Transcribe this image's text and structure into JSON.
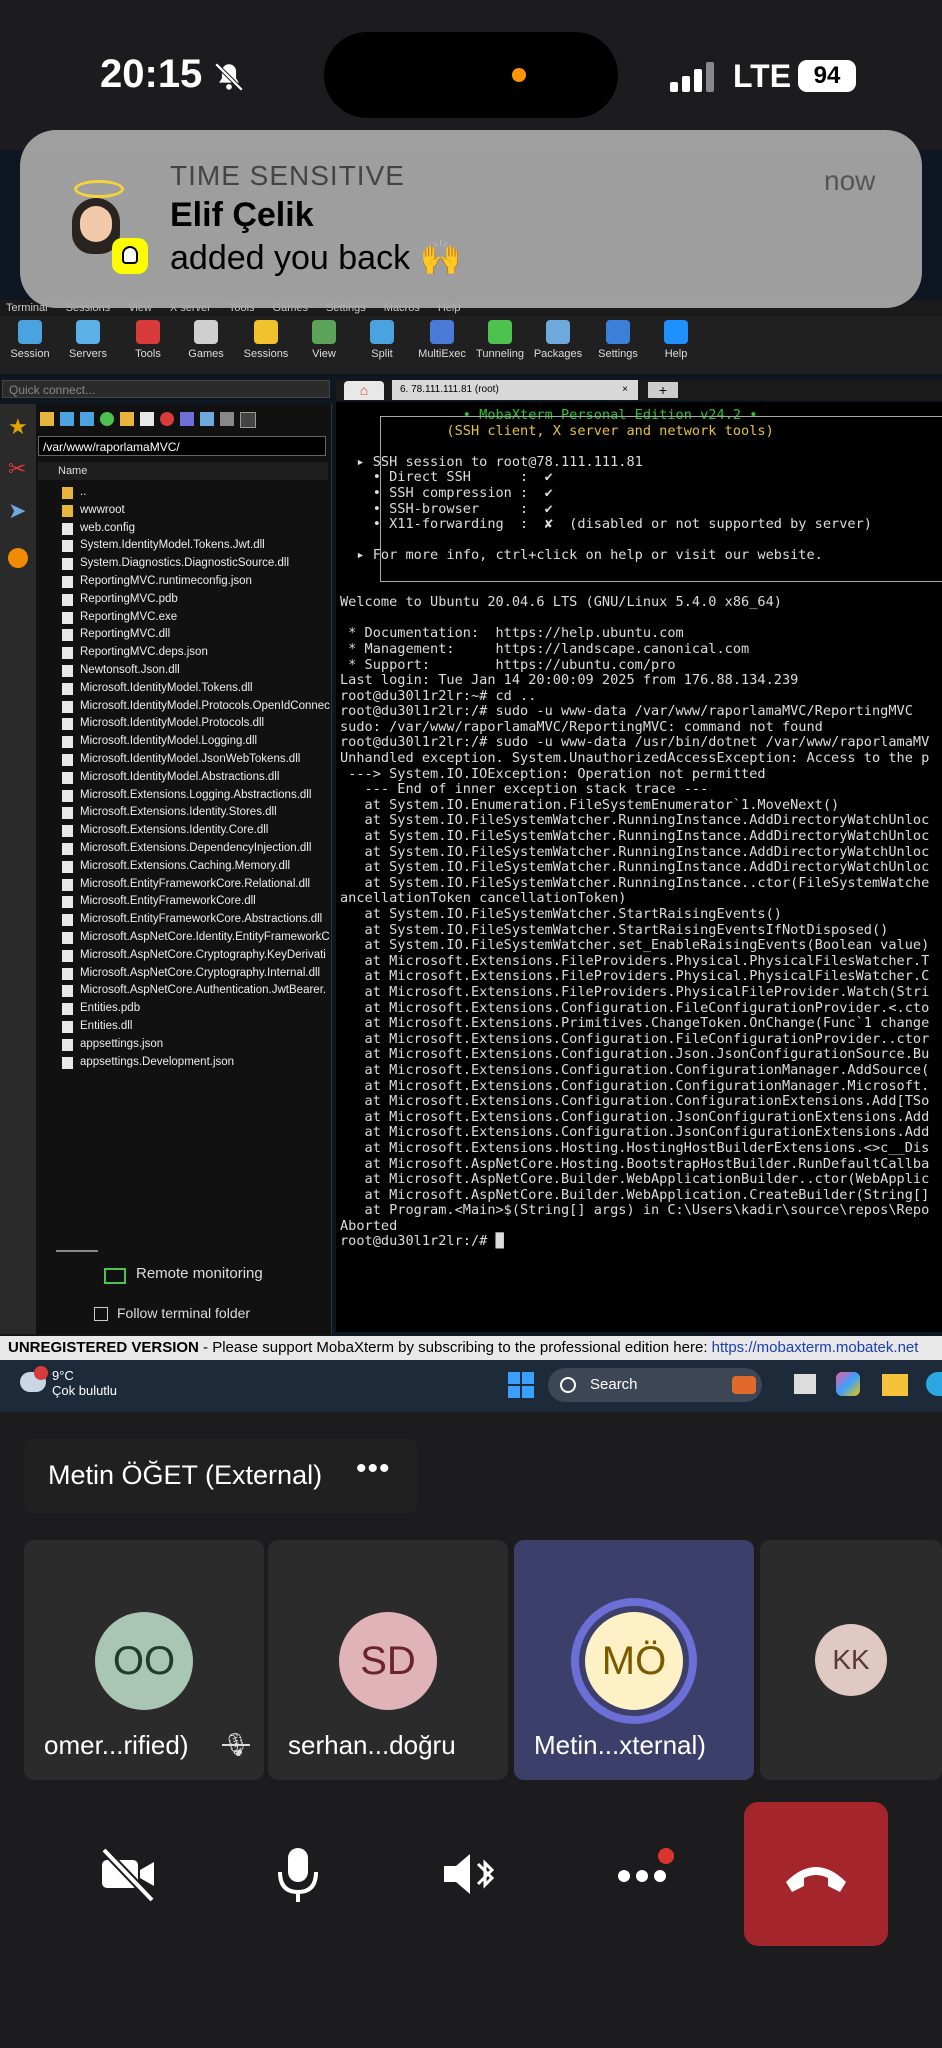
{
  "status_bar": {
    "time": "20:15",
    "network": "LTE",
    "battery": "94"
  },
  "notification": {
    "tag": "TIME SENSITIVE",
    "time": "now",
    "title": "Elif Çelik",
    "body": "added you back 🙌"
  },
  "moba": {
    "menu": [
      "Terminal",
      "Sessions",
      "View",
      "X server",
      "Tools",
      "Games",
      "Settings",
      "Macros",
      "Help"
    ],
    "toolbar": [
      {
        "label": "Session",
        "color": "#4aa3df"
      },
      {
        "label": "Servers",
        "color": "#5bb0e8"
      },
      {
        "label": "Tools",
        "color": "#d83b3b"
      },
      {
        "label": "Games",
        "color": "#cfcfcf"
      },
      {
        "label": "Sessions",
        "color": "#f2c12e"
      },
      {
        "label": "View",
        "color": "#5ca35c"
      },
      {
        "label": "Split",
        "color": "#4aa3df"
      },
      {
        "label": "MultiExec",
        "color": "#4a7bd8"
      },
      {
        "label": "Tunneling",
        "color": "#4ec24e"
      },
      {
        "label": "Packages",
        "color": "#6fa8dc"
      },
      {
        "label": "Settings",
        "color": "#3c7fd8"
      },
      {
        "label": "Help",
        "color": "#1e90ff"
      }
    ],
    "quick_connect_placeholder": "Quick connect...",
    "path": "/var/www/raporlamaMVC/",
    "name_header": "Name",
    "files": [
      {
        "name": "..",
        "dir": true
      },
      {
        "name": "wwwroot",
        "dir": true
      },
      {
        "name": "web.config"
      },
      {
        "name": "System.IdentityModel.Tokens.Jwt.dll"
      },
      {
        "name": "System.Diagnostics.DiagnosticSource.dll"
      },
      {
        "name": "ReportingMVC.runtimeconfig.json"
      },
      {
        "name": "ReportingMVC.pdb"
      },
      {
        "name": "ReportingMVC.exe"
      },
      {
        "name": "ReportingMVC.dll"
      },
      {
        "name": "ReportingMVC.deps.json"
      },
      {
        "name": "Newtonsoft.Json.dll"
      },
      {
        "name": "Microsoft.IdentityModel.Tokens.dll"
      },
      {
        "name": "Microsoft.IdentityModel.Protocols.OpenIdConnect"
      },
      {
        "name": "Microsoft.IdentityModel.Protocols.dll"
      },
      {
        "name": "Microsoft.IdentityModel.Logging.dll"
      },
      {
        "name": "Microsoft.IdentityModel.JsonWebTokens.dll"
      },
      {
        "name": "Microsoft.IdentityModel.Abstractions.dll"
      },
      {
        "name": "Microsoft.Extensions.Logging.Abstractions.dll"
      },
      {
        "name": "Microsoft.Extensions.Identity.Stores.dll"
      },
      {
        "name": "Microsoft.Extensions.Identity.Core.dll"
      },
      {
        "name": "Microsoft.Extensions.DependencyInjection.dll"
      },
      {
        "name": "Microsoft.Extensions.Caching.Memory.dll"
      },
      {
        "name": "Microsoft.EntityFrameworkCore.Relational.dll"
      },
      {
        "name": "Microsoft.EntityFrameworkCore.dll"
      },
      {
        "name": "Microsoft.EntityFrameworkCore.Abstractions.dll"
      },
      {
        "name": "Microsoft.AspNetCore.Identity.EntityFrameworkC"
      },
      {
        "name": "Microsoft.AspNetCore.Cryptography.KeyDerivati"
      },
      {
        "name": "Microsoft.AspNetCore.Cryptography.Internal.dll"
      },
      {
        "name": "Microsoft.AspNetCore.Authentication.JwtBearer."
      },
      {
        "name": "Entities.pdb"
      },
      {
        "name": "Entities.dll"
      },
      {
        "name": "appsettings.json"
      },
      {
        "name": "appsettings.Development.json"
      }
    ],
    "remote_monitoring": "Remote monitoring",
    "follow_terminal": "Follow terminal folder",
    "tab_label": "6. 78.111.111.81 (root)",
    "terminal_lines": [
      {
        "t": "               • MobaXterm Personal Edition v24.2 •",
        "c": "grn"
      },
      {
        "t": "             (SSH client, X server and network tools)",
        "c": "yel"
      },
      {
        "t": "",
        "c": ""
      },
      {
        "t": "  ▸ SSH session to root@78.111.111.81",
        "c": ""
      },
      {
        "t": "    • Direct SSH      :  ✔",
        "c": ""
      },
      {
        "t": "    • SSH compression :  ✔",
        "c": ""
      },
      {
        "t": "    • SSH-browser     :  ✔",
        "c": ""
      },
      {
        "t": "    • X11-forwarding  :  ✘  (disabled or not supported by server)",
        "c": ""
      },
      {
        "t": "",
        "c": ""
      },
      {
        "t": "  ▸ For more info, ctrl+click on help or visit our website.",
        "c": ""
      },
      {
        "t": "",
        "c": ""
      },
      {
        "t": "",
        "c": ""
      },
      {
        "t": "Welcome to Ubuntu 20.04.6 LTS (GNU/Linux 5.4.0 x86_64)",
        "c": ""
      },
      {
        "t": "",
        "c": ""
      },
      {
        "t": " * Documentation:  https://help.ubuntu.com",
        "c": ""
      },
      {
        "t": " * Management:     https://landscape.canonical.com",
        "c": ""
      },
      {
        "t": " * Support:        https://ubuntu.com/pro",
        "c": ""
      },
      {
        "t": "Last login: Tue Jan 14 20:00:09 2025 from 176.88.134.239",
        "c": ""
      },
      {
        "t": "root@du30l1r2lr:~# cd ..",
        "c": ""
      },
      {
        "t": "root@du30l1r2lr:/# sudo -u www-data /var/www/raporlamaMVC/ReportingMVC",
        "c": ""
      },
      {
        "t": "sudo: /var/www/raporlamaMVC/ReportingMVC: command not found",
        "c": ""
      },
      {
        "t": "root@du30l1r2lr:/# sudo -u www-data /usr/bin/dotnet /var/www/raporlamaMV",
        "c": ""
      },
      {
        "t": "Unhandled exception. System.UnauthorizedAccessException: Access to the p",
        "c": ""
      },
      {
        "t": " ---> System.IO.IOException: Operation not permitted",
        "c": ""
      },
      {
        "t": "   --- End of inner exception stack trace ---",
        "c": ""
      },
      {
        "t": "   at System.IO.Enumeration.FileSystemEnumerator`1.MoveNext()",
        "c": ""
      },
      {
        "t": "   at System.IO.FileSystemWatcher.RunningInstance.AddDirectoryWatchUnloc",
        "c": ""
      },
      {
        "t": "   at System.IO.FileSystemWatcher.RunningInstance.AddDirectoryWatchUnloc",
        "c": ""
      },
      {
        "t": "   at System.IO.FileSystemWatcher.RunningInstance.AddDirectoryWatchUnloc",
        "c": ""
      },
      {
        "t": "   at System.IO.FileSystemWatcher.RunningInstance.AddDirectoryWatchUnloc",
        "c": ""
      },
      {
        "t": "   at System.IO.FileSystemWatcher.RunningInstance..ctor(FileSystemWatche",
        "c": ""
      },
      {
        "t": "ancellationToken cancellationToken)",
        "c": ""
      },
      {
        "t": "   at System.IO.FileSystemWatcher.StartRaisingEvents()",
        "c": ""
      },
      {
        "t": "   at System.IO.FileSystemWatcher.StartRaisingEventsIfNotDisposed()",
        "c": ""
      },
      {
        "t": "   at System.IO.FileSystemWatcher.set_EnableRaisingEvents(Boolean value)",
        "c": ""
      },
      {
        "t": "   at Microsoft.Extensions.FileProviders.Physical.PhysicalFilesWatcher.T",
        "c": ""
      },
      {
        "t": "   at Microsoft.Extensions.FileProviders.Physical.PhysicalFilesWatcher.C",
        "c": ""
      },
      {
        "t": "   at Microsoft.Extensions.FileProviders.PhysicalFileProvider.Watch(Stri",
        "c": ""
      },
      {
        "t": "   at Microsoft.Extensions.Configuration.FileConfigurationProvider.<.cto",
        "c": ""
      },
      {
        "t": "   at Microsoft.Extensions.Primitives.ChangeToken.OnChange(Func`1 change",
        "c": ""
      },
      {
        "t": "   at Microsoft.Extensions.Configuration.FileConfigurationProvider..ctor",
        "c": ""
      },
      {
        "t": "   at Microsoft.Extensions.Configuration.Json.JsonConfigurationSource.Bu",
        "c": ""
      },
      {
        "t": "   at Microsoft.Extensions.Configuration.ConfigurationManager.AddSource(",
        "c": ""
      },
      {
        "t": "   at Microsoft.Extensions.Configuration.ConfigurationManager.Microsoft.",
        "c": ""
      },
      {
        "t": "   at Microsoft.Extensions.Configuration.ConfigurationExtensions.Add[TSo",
        "c": ""
      },
      {
        "t": "   at Microsoft.Extensions.Configuration.JsonConfigurationExtensions.Add",
        "c": ""
      },
      {
        "t": "   at Microsoft.Extensions.Configuration.JsonConfigurationExtensions.Add",
        "c": ""
      },
      {
        "t": "   at Microsoft.Extensions.Hosting.HostingHostBuilderExtensions.<>c__Dis",
        "c": ""
      },
      {
        "t": "   at Microsoft.AspNetCore.Hosting.BootstrapHostBuilder.RunDefaultCallba",
        "c": ""
      },
      {
        "t": "   at Microsoft.AspNetCore.Builder.WebApplicationBuilder..ctor(WebApplic",
        "c": ""
      },
      {
        "t": "   at Microsoft.AspNetCore.Builder.WebApplication.CreateBuilder(String[]",
        "c": ""
      },
      {
        "t": "   at Program.<Main>$(String[] args) in C:\\Users\\kadir\\source\\repos\\Repo",
        "c": ""
      },
      {
        "t": "Aborted",
        "c": ""
      },
      {
        "t": "root@du30l1r2lr:/# █",
        "c": ""
      }
    ],
    "unregistered": "UNREGISTERED VERSION",
    "support_text": " -  Please support MobaXterm by subscribing to the professional edition here:  ",
    "support_link": "https://mobaxterm.mobatek.net"
  },
  "taskbar": {
    "temp": "9°C",
    "weather": "Çok bulutlu",
    "search_placeholder": "Search"
  },
  "call": {
    "presenter": "Metin ÖĞET (External)",
    "participants": [
      {
        "initials": "OO",
        "name": "omer...rified)",
        "bg": "#a9c6b4",
        "fg": "#1f3b2c",
        "muted": true
      },
      {
        "initials": "SD",
        "name": "serhan...doğru",
        "bg": "#e0b3b9",
        "fg": "#6b2230",
        "muted": false
      },
      {
        "initials": "MÖ",
        "name": "Metin...xternal)",
        "bg": "#fff1c6",
        "fg": "#7a5a00",
        "muted": false,
        "speaking": true
      },
      {
        "initials": "KK",
        "name": "",
        "bg": "#e0c8c3",
        "fg": "#5a3a33",
        "muted": false
      }
    ]
  },
  "colors": {
    "end_call": "#a4262c",
    "active_tile": "#3d3f6b",
    "speaking_ring": "#6b6fd6"
  }
}
